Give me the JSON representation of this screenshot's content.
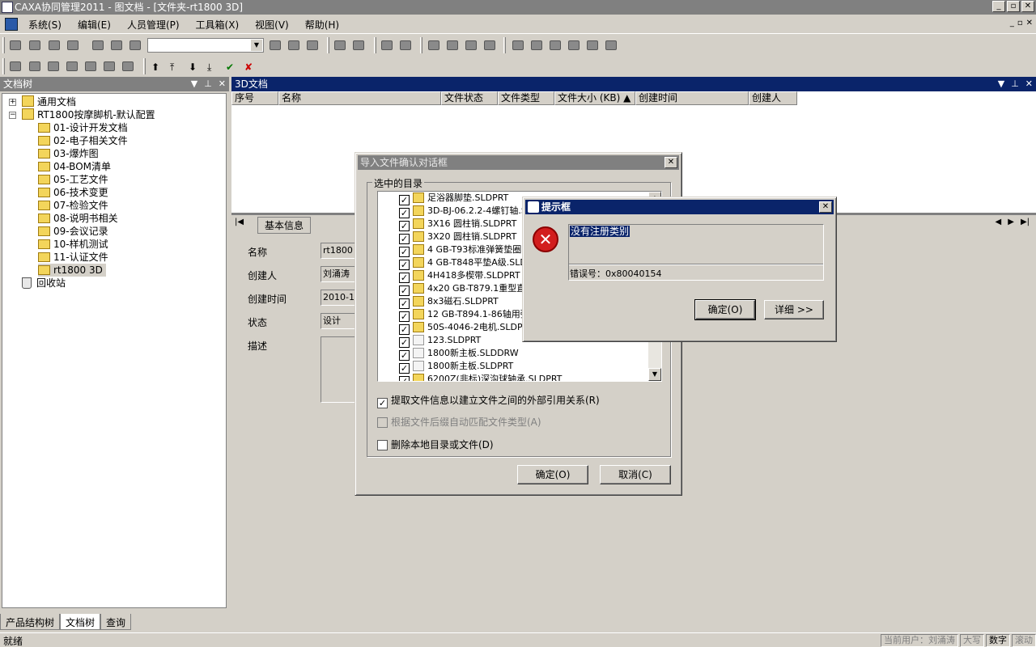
{
  "window": {
    "title": "CAXA协同管理2011 - 图文档 - [文件夹-rt1800 3D]"
  },
  "menu": [
    "系统(S)",
    "编辑(E)",
    "人员管理(P)",
    "工具箱(X)",
    "视图(V)",
    "帮助(H)"
  ],
  "left_pane": {
    "title": "文档树",
    "tree": {
      "root1": "通用文档",
      "root2": "RT1800按摩脚机-默认配置",
      "folders": [
        "01-设计开发文档",
        "02-电子相关文件",
        "03-爆炸图",
        "04-BOM清单",
        "05-工艺文件",
        "06-技术变更",
        "07-检验文件",
        "08-说明书相关",
        "09-会议记录",
        "10-样机测试",
        "11-认证文件",
        "rt1800 3D"
      ],
      "recycle": "回收站"
    },
    "tabs": [
      "产品结构树",
      "文档树",
      "查询"
    ]
  },
  "right_pane": {
    "title": "3D文档",
    "columns": [
      "序号",
      "名称",
      "文件状态",
      "文件类型",
      "文件大小 (KB)",
      "创建时间",
      "创建人"
    ],
    "detail_tab": "基本信息",
    "fields": {
      "name_label": "名称",
      "name_value": "rt1800",
      "creator_label": "创建人",
      "creator_value": "刘涌涛",
      "created_label": "创建时间",
      "created_value": "2010-12",
      "status_label": "状态",
      "status_value": "设计",
      "desc_label": "描述"
    }
  },
  "import_dialog": {
    "title": "导入文件确认对话框",
    "group_label": "选中的目录",
    "files": [
      "足浴器脚垫.SLDPRT",
      "3D-BJ-06.2.2-4螺钉轴.S",
      "3X16 圆柱销.SLDPRT",
      "3X20 圆柱销.SLDPRT",
      "4 GB-T93标准弹簧垫圈.",
      "4 GB-T848平垫A级.SLDP",
      "4H418多楔带.SLDPRT",
      "4x20 GB-T879.1重型直销",
      "8x3磁石.SLDPRT",
      "12 GB-T894.1-86轴用弹",
      "50S-4046-2电机.SLDPRT",
      "123.SLDPRT",
      "1800新主板.SLDDRW",
      "1800新主板.SLDPRT",
      "6200Z(非标)深沟球轴承.SLDPRT"
    ],
    "opt_extract": "提取文件信息以建立文件之间的外部引用关系(R)",
    "opt_auto": "根据文件后缀自动匹配文件类型(A)",
    "opt_delete": "删除本地目录或文件(D)",
    "ok": "确定(O)",
    "cancel": "取消(C)"
  },
  "message_box": {
    "title": "提示框",
    "message": "没有注册类别",
    "error_code": "错误号：0x80040154",
    "ok": "确定(O)",
    "detail": "详细 >>"
  },
  "status": {
    "ready": "就绪",
    "user": "当前用户：刘涌涛",
    "caps": "大写",
    "num": "数字",
    "scroll": "滚动"
  }
}
